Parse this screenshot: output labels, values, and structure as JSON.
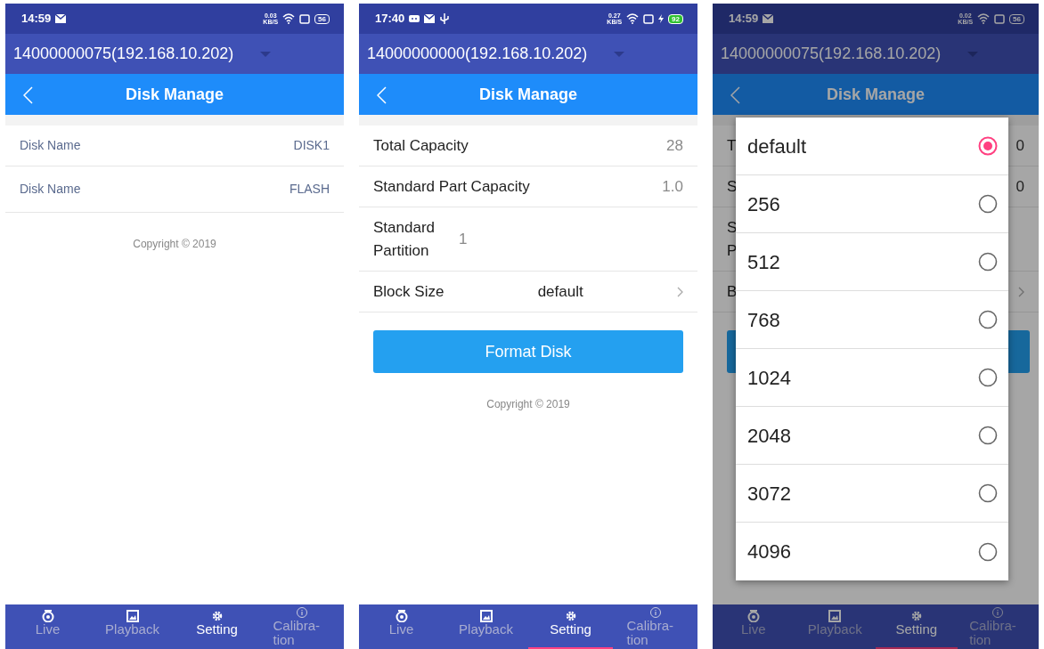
{
  "screens": [
    {
      "kind": "disk_list",
      "status_bar": {
        "time": "14:59",
        "notifications": [
          {
            "kind": "mail"
          }
        ],
        "speed": "0.03",
        "speed_unit": "KB/S",
        "battery": "56",
        "charging": false
      },
      "device": "14000000075(192.168.10.202)",
      "title": "Disk Manage",
      "rows": [
        {
          "kind": "info",
          "label": "Disk Name",
          "value": "DISK1"
        },
        {
          "kind": "info",
          "label": "Disk Name",
          "value": "FLASH"
        }
      ],
      "copyright": "Copyright © 2019",
      "tabs": [
        {
          "label": "Live",
          "selected": false
        },
        {
          "label": "Playback",
          "selected": false
        },
        {
          "label": "Setting",
          "selected": true
        },
        {
          "label": "Calibra-tion",
          "selected": false
        }
      ],
      "tab_indicator": false
    },
    {
      "kind": "form",
      "status_bar": {
        "time": "17:40",
        "notifications": [
          {
            "kind": "message"
          },
          {
            "kind": "mail"
          },
          {
            "kind": "usb"
          }
        ],
        "speed": "0.27",
        "speed_unit": "KB/S",
        "battery": "92",
        "charging": true
      },
      "device": "14000000000(192.168.10.202)",
      "title": "Disk Manage",
      "rows": [
        {
          "kind": "info",
          "label": "Total Capacity",
          "value": "28"
        },
        {
          "kind": "info",
          "label": "Standard Part Capacity",
          "value": "1.0"
        },
        {
          "kind": "near",
          "label": "Standard Partition",
          "value": "1"
        },
        {
          "kind": "select",
          "label": "Block Size",
          "value": "default"
        }
      ],
      "button": "Format Disk",
      "copyright": "Copyright © 2019",
      "tabs": [
        {
          "label": "Live",
          "selected": false
        },
        {
          "label": "Playback",
          "selected": false
        },
        {
          "label": "Setting",
          "selected": true
        },
        {
          "label": "Calibra-tion",
          "selected": false
        }
      ],
      "tab_indicator": true
    },
    {
      "kind": "form_dialog",
      "status_bar": {
        "time": "14:59",
        "notifications": [
          {
            "kind": "mail"
          }
        ],
        "speed": "0.02",
        "speed_unit": "KB/S",
        "battery": "56",
        "charging": false
      },
      "device": "14000000075(192.168.10.202)",
      "title": "Disk Manage",
      "rows": [
        {
          "kind": "info",
          "label": "T",
          "value": "0"
        },
        {
          "kind": "info",
          "label": "S",
          "value": "0"
        },
        {
          "kind": "near",
          "label": "S\nP"
        },
        {
          "kind": "select",
          "label": "B"
        }
      ],
      "tabs": [
        {
          "label": "Live",
          "selected": false
        },
        {
          "label": "Playback",
          "selected": false
        },
        {
          "label": "Setting",
          "selected": true
        },
        {
          "label": "Calibra-tion",
          "selected": false
        }
      ],
      "tab_indicator": true,
      "dialog": {
        "options": [
          {
            "label": "default",
            "selected": true
          },
          {
            "label": "256",
            "selected": false
          },
          {
            "label": "512",
            "selected": false
          },
          {
            "label": "768",
            "selected": false
          },
          {
            "label": "1024",
            "selected": false
          },
          {
            "label": "2048",
            "selected": false
          },
          {
            "label": "3072",
            "selected": false
          },
          {
            "label": "4096",
            "selected": false
          }
        ]
      }
    }
  ]
}
